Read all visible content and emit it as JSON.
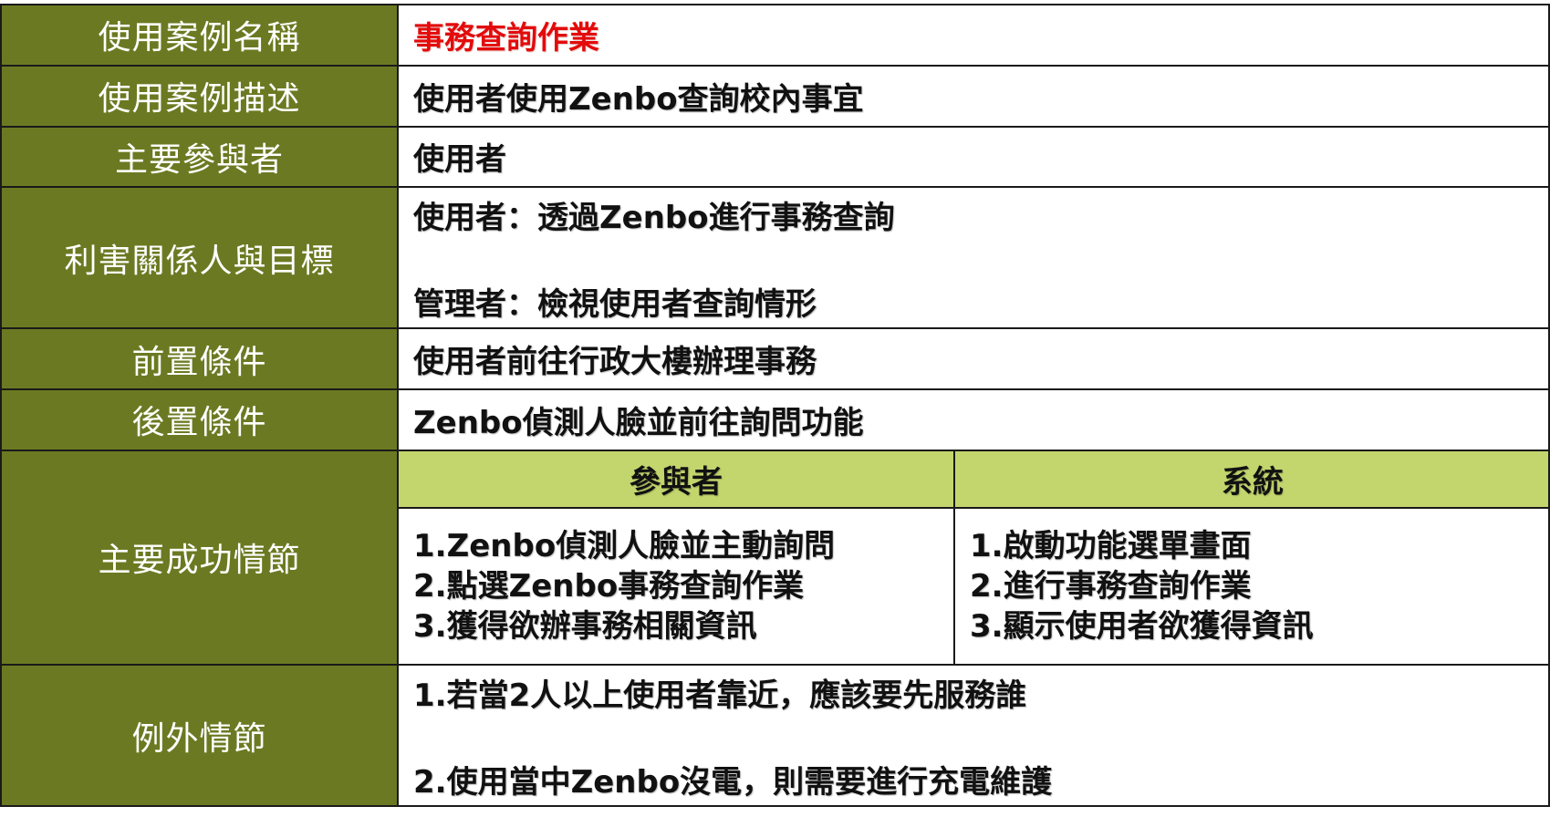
{
  "rows": {
    "use_case_name": {
      "label": "使用案例名稱",
      "value": "事務查詢作業"
    },
    "use_case_desc": {
      "label": "使用案例描述",
      "value": "使用者使用Zenbo查詢校內事宜"
    },
    "primary_actor": {
      "label": "主要參與者",
      "value": "使用者"
    },
    "stakeholders": {
      "label": "利害關係人與目標",
      "lines": [
        "使用者：透過Zenbo進行事務查詢",
        "管理者：檢視使用者查詢情形"
      ]
    },
    "preconditions": {
      "label": "前置條件",
      "value": "使用者前往行政大樓辦理事務"
    },
    "postconditions": {
      "label": "後置條件",
      "value": "Zenbo偵測人臉並前往詢問功能"
    },
    "main_scenario": {
      "label": "主要成功情節",
      "actor_header": "參與者",
      "system_header": "系統",
      "actor_steps": [
        "1.Zenbo偵測人臉並主動詢問",
        "2.點選Zenbo事務查詢作業",
        "3.獲得欲辦事務相關資訊"
      ],
      "system_steps": [
        "1.啟動功能選單畫面",
        "2.進行事務查詢作業",
        "3.顯示使用者欲獲得資訊"
      ]
    },
    "exceptions": {
      "label": "例外情節",
      "lines": [
        "1.若當2人以上使用者靠近，應該要先服務誰",
        "2.使用當中Zenbo沒電，則需要進行充電維護"
      ]
    }
  },
  "colors": {
    "label_bg": "#6b7a22",
    "subheader_bg": "#c3d56d",
    "highlight_text": "#e30b0b"
  }
}
